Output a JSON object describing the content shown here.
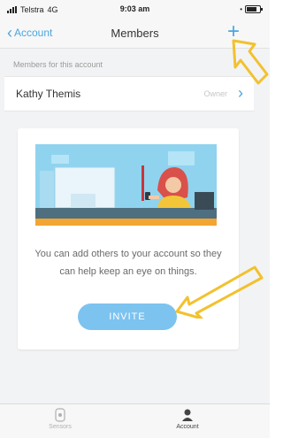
{
  "status_bar": {
    "carrier": "Telstra",
    "network": "4G",
    "time": "9:03 am"
  },
  "nav": {
    "back_label": "Account",
    "title": "Members",
    "add_label": "+"
  },
  "members_section": {
    "header": "Members for this account",
    "members": [
      {
        "name": "Kathy Themis",
        "role": "Owner"
      }
    ]
  },
  "invite_card": {
    "message": "You can add others to your account so they can help keep an eye on things.",
    "button_label": "INVITE"
  },
  "tab_bar": {
    "tabs": [
      {
        "label": "Sensors",
        "icon": "sensor-icon",
        "active": false
      },
      {
        "label": "Account",
        "icon": "person-icon",
        "active": true
      }
    ]
  },
  "colors": {
    "accent": "#4aa6e0",
    "button": "#7cc3ef",
    "annotation_arrow": "#f2c12e",
    "background": "#f2f3f5"
  }
}
